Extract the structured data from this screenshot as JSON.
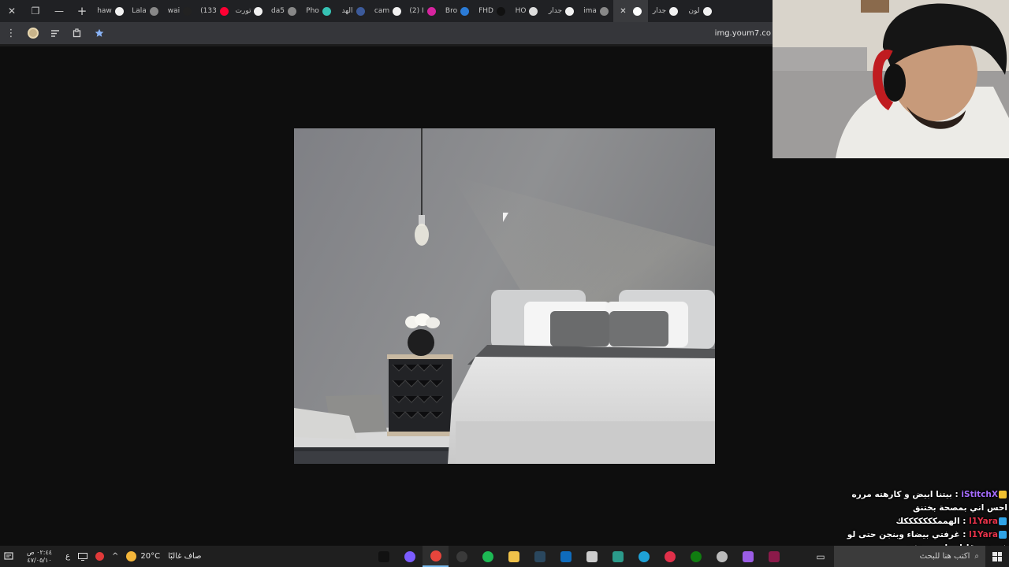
{
  "browser": {
    "window_controls": [
      "✕",
      "❐",
      "—"
    ],
    "new_tab": "+",
    "tabs": [
      {
        "label": "لون",
        "color": "#f1f1f1"
      },
      {
        "label": "جدار",
        "color": "#f1f1f1"
      },
      {
        "label": "",
        "color": "#ffffff",
        "active": true
      },
      {
        "label": "ima",
        "color": "#888888"
      },
      {
        "label": "جدار",
        "color": "#f1f1f1"
      },
      {
        "label": "HO",
        "color": "#dddddd"
      },
      {
        "label": "FHD",
        "color": "#111111"
      },
      {
        "label": "Bro",
        "color": "#2b7bd6"
      },
      {
        "label": "(2) I",
        "color": "#d6249f"
      },
      {
        "label": "cam",
        "color": "#f1f1f1"
      },
      {
        "label": "الهد",
        "color": "#3c5a9a"
      },
      {
        "label": "Pho",
        "color": "#36c2b4"
      },
      {
        "label": "da5",
        "color": "#888888"
      },
      {
        "label": "تورت",
        "color": "#f1f1f1"
      },
      {
        "label": "(133",
        "color": "#ff0033"
      },
      {
        "label": "wai",
        "color": "#222222"
      },
      {
        "label": "Lala",
        "color": "#888888"
      },
      {
        "label": "haw",
        "color": "#f1f1f1"
      }
    ],
    "toolbar": {
      "menu_icon": "⋮",
      "url": "img.youm7.co"
    }
  },
  "chat": {
    "messages": [
      {
        "user": "iStitchX",
        "text": "بيتنا ابيض و كارهته مرره احس اني بمصحة بختنق",
        "user_color": "#a66cff"
      },
      {
        "user": "l1Yara",
        "text": "الهممكككككككك",
        "user_color": "#e8334a"
      },
      {
        "user": "l1Yara",
        "text": "غرفتي بيضاء وبنجن حتى لو في نور قليل راسي ينفجر",
        "user_color": "#e8334a"
      }
    ]
  },
  "taskbar": {
    "clock_time": "٠٢:٤٤ ص",
    "clock_date": "٤٧/٠٥/١٠",
    "lang": "ع",
    "weather_temp": "20°C",
    "weather_text": "صاف غالبًا",
    "search_placeholder": "اكتب هنا للبحث",
    "apps": [
      {
        "name": "tiktok",
        "color": "#111111"
      },
      {
        "name": "app-purple",
        "color": "#7b5cff"
      },
      {
        "name": "chrome",
        "color": "#e8453c"
      },
      {
        "name": "obs",
        "color": "#3a3a3a"
      },
      {
        "name": "spotify",
        "color": "#1db954"
      },
      {
        "name": "explorer",
        "color": "#f0c24a"
      },
      {
        "name": "steam",
        "color": "#2a475e"
      },
      {
        "name": "outlook",
        "color": "#0f6cbd"
      },
      {
        "name": "store",
        "color": "#cccccc"
      },
      {
        "name": "app-tools",
        "color": "#2b9a8a"
      },
      {
        "name": "edge",
        "color": "#1fa1d6"
      },
      {
        "name": "app-red",
        "color": "#e0304a"
      },
      {
        "name": "xbox",
        "color": "#107c10"
      },
      {
        "name": "settings",
        "color": "#bbbbbb"
      },
      {
        "name": "copilot",
        "color": "#9b5de5"
      },
      {
        "name": "winrar",
        "color": "#8b1a4a"
      }
    ]
  }
}
